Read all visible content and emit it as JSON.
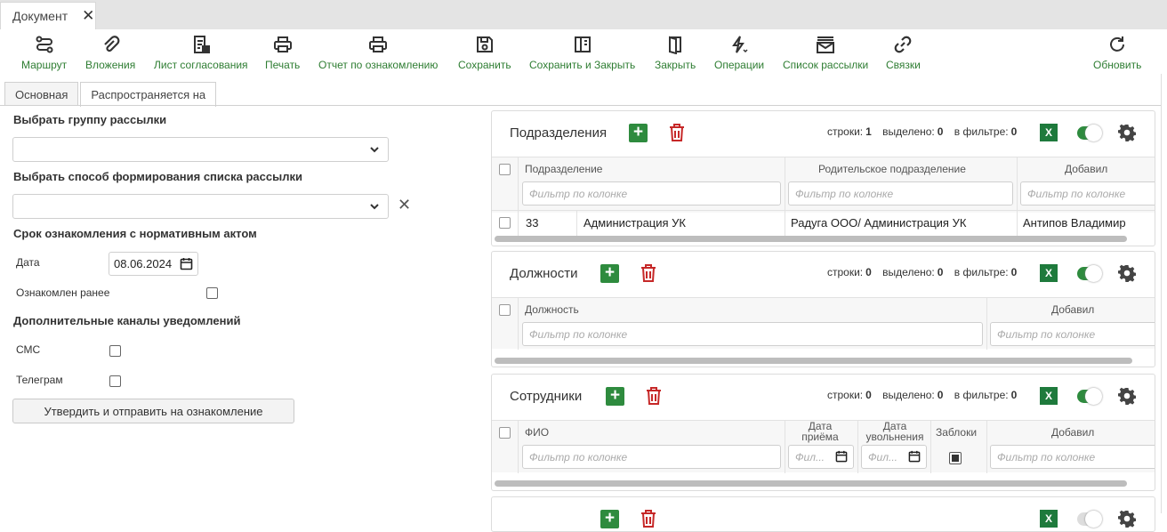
{
  "doc_tab": {
    "label": "Документ",
    "close": "✕"
  },
  "toolbar": {
    "route": "Маршрут",
    "attachments": "Вложения",
    "approval_sheet": "Лист согласования",
    "print": "Печать",
    "ack_report": "Отчет по ознакомлению",
    "save": "Сохранить",
    "save_close": "Сохранить и Закрыть",
    "close": "Закрыть",
    "operations": "Операции",
    "mailing_list": "Список рассылки",
    "links": "Связки",
    "refresh": "Обновить"
  },
  "tabs": {
    "main": "Основная",
    "applies_to": "Распространяется на"
  },
  "form": {
    "group_label": "Выбрать группу рассылки",
    "method_label": "Выбрать способ формирования списка рассылки",
    "term_heading": "Срок ознакомления с нормативным актом",
    "date_label": "Дата",
    "date_value": "08.06.2024",
    "familiar_label": "Ознакомлен ранее",
    "channels_heading": "Дополнительные каналы уведомлений",
    "sms_label": "СМС",
    "telegram_label": "Телеграм",
    "submit_label": "Утвердить и отправить на ознакомление"
  },
  "stats_labels": {
    "rows": "строки:",
    "selected": "выделено:",
    "in_filter": "в фильтре:"
  },
  "filter_placeholder": "Фильтр по колонке",
  "filter_short": "Фил...",
  "excel_label": "X",
  "panels": {
    "departments": {
      "title": "Подразделения",
      "rows": "1",
      "selected": "0",
      "in_filter": "0",
      "columns": {
        "department": "Подразделение",
        "parent": "Родительское подразделение",
        "added_by": "Добавил"
      },
      "row": {
        "code": "33",
        "name": "Администрация УК",
        "parent": "Радуга ООО/ Администрация УК",
        "added_by": "Антипов Владимир"
      }
    },
    "positions": {
      "title": "Должности",
      "rows": "0",
      "selected": "0",
      "in_filter": "0",
      "columns": {
        "position": "Должность",
        "added_by": "Добавил"
      }
    },
    "employees": {
      "title": "Сотрудники",
      "rows": "0",
      "selected": "0",
      "in_filter": "0",
      "columns": {
        "fio": "ФИО",
        "hire_date_1": "Дата",
        "hire_date_2": "приёма",
        "fire_date_1": "Дата",
        "fire_date_2": "увольнения",
        "blocked": "Заблоки",
        "added_by": "Добавил"
      }
    }
  }
}
